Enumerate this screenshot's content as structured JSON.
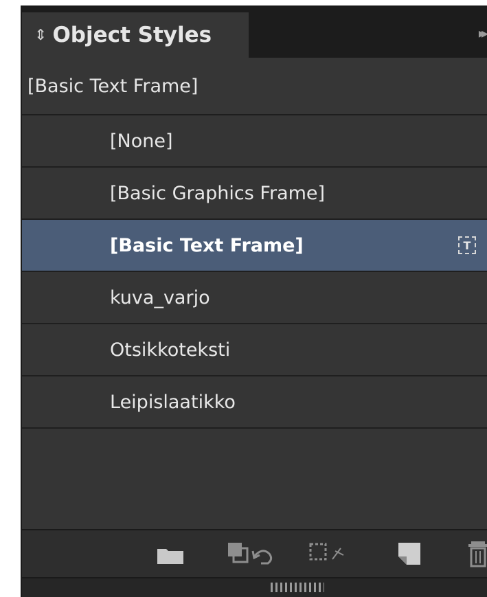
{
  "panel": {
    "tab_label": "Object Styles",
    "tab_arrows": "⇕",
    "current_style": "[Basic Text Frame]"
  },
  "styles": [
    {
      "label": "[None]"
    },
    {
      "label": "[Basic Graphics Frame]"
    },
    {
      "label": "[Basic Text Frame]",
      "selected": true,
      "default_text_frame_icon": "T"
    },
    {
      "label": "kuva_varjo"
    },
    {
      "label": "Otsikkoteksti"
    },
    {
      "label": "Leipislaatikko"
    }
  ],
  "toolbar": {
    "icons": [
      "folder-icon",
      "clear-overrides-icon",
      "clear-attributes-icon",
      "new-style-icon",
      "trash-icon"
    ]
  },
  "colors": {
    "panel_bg": "#2b2b2b",
    "selected_row": "#4b5d78",
    "text": "#e8e8e8"
  }
}
